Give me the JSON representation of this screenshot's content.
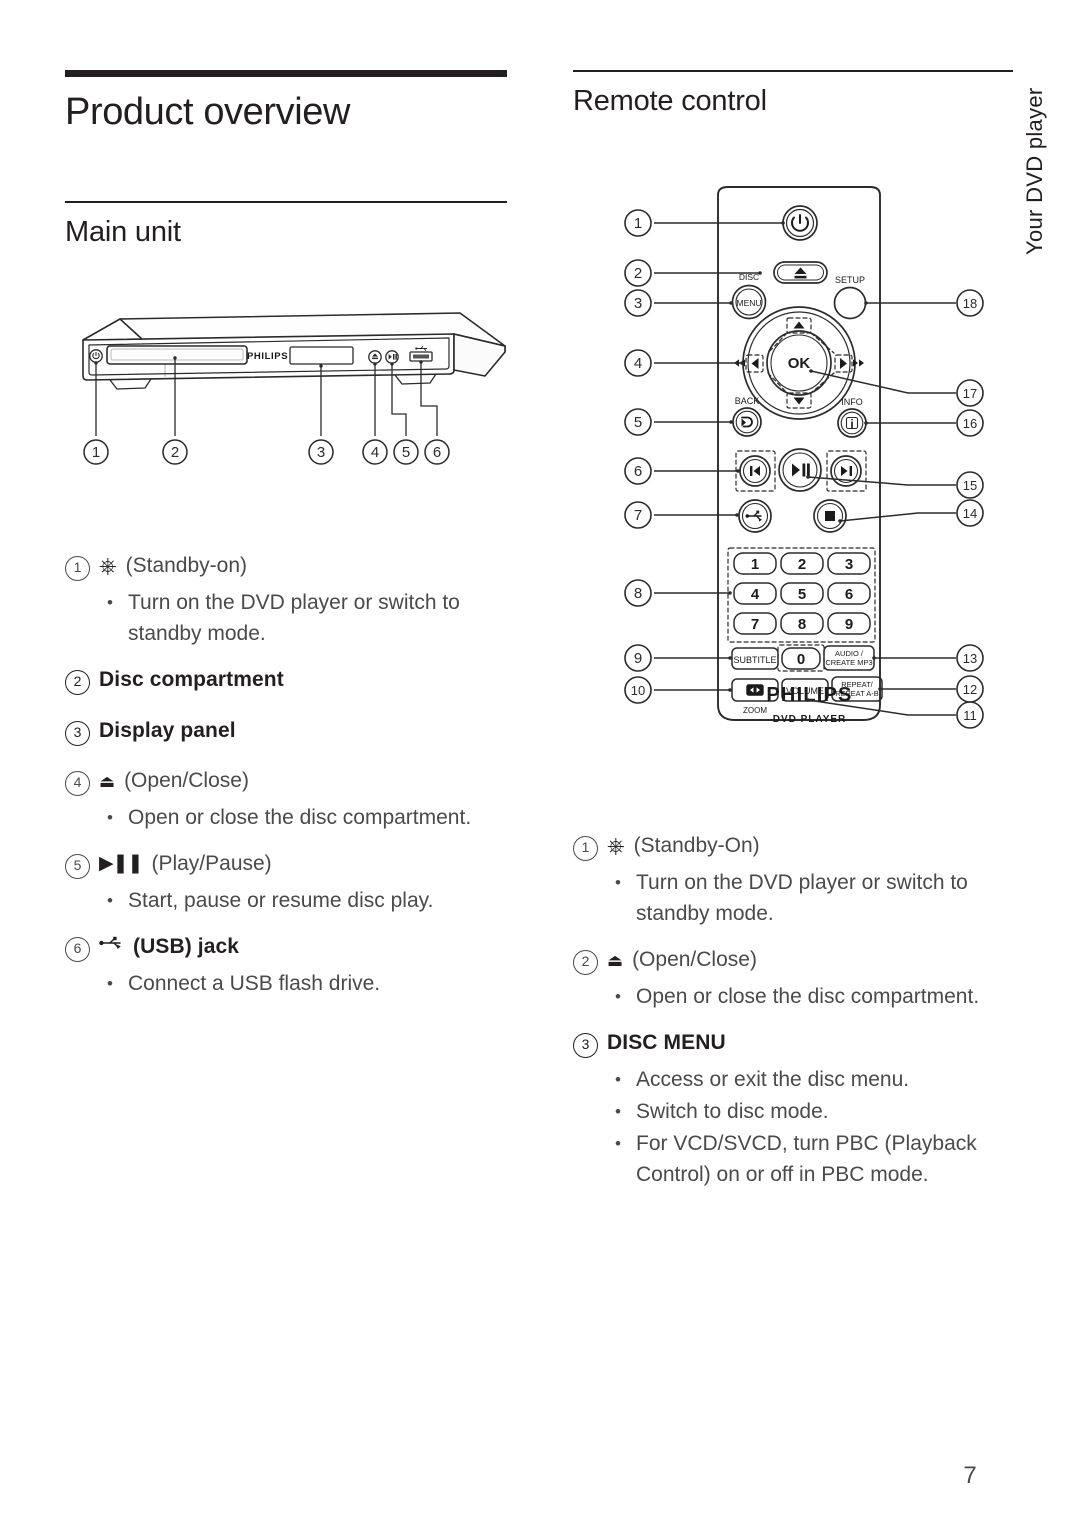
{
  "page": {
    "number": "7",
    "side_tab": "Your DVD player"
  },
  "left_column": {
    "title": "Product overview",
    "section_title": "Main unit",
    "entries": [
      {
        "num": "1",
        "icon": "power-standby-icon",
        "label": "(Standby-on)",
        "bold": false,
        "bullets": [
          "Turn on the DVD player or switch to standby mode."
        ]
      },
      {
        "num": "2",
        "icon": "",
        "label": "Disc compartment",
        "bold": true,
        "bullets": []
      },
      {
        "num": "3",
        "icon": "",
        "label": "Display panel",
        "bold": true,
        "bullets": []
      },
      {
        "num": "4",
        "icon": "eject-icon",
        "label": "(Open/Close)",
        "bold": false,
        "bullets": [
          "Open or close the disc compartment."
        ]
      },
      {
        "num": "5",
        "icon": "play-pause-icon",
        "label": "(Play/Pause)",
        "bold": false,
        "bullets": [
          "Start, pause or resume disc play."
        ]
      },
      {
        "num": "6",
        "icon": "usb-icon",
        "label": "(USB) jack",
        "bold": true,
        "bullets": [
          "Connect a USB flash drive."
        ]
      }
    ]
  },
  "right_column": {
    "section_title": "Remote control",
    "entries": [
      {
        "num": "1",
        "icon": "power-standby-icon",
        "label": "(Standby-On)",
        "bold": false,
        "bullets": [
          "Turn on the DVD player or switch to standby mode."
        ]
      },
      {
        "num": "2",
        "icon": "eject-icon",
        "label": "(Open/Close)",
        "bold": false,
        "bullets": [
          "Open or close the disc compartment."
        ]
      },
      {
        "num": "3",
        "icon": "",
        "label": "DISC MENU",
        "bold": true,
        "bullets": [
          "Access or exit the disc menu.",
          "Switch to disc mode.",
          "For VCD/SVCD, turn PBC (Playback Control) on or off in PBC mode."
        ]
      }
    ]
  },
  "main_unit_diagram": {
    "brand": "PHILIPS",
    "callouts": [
      "1",
      "2",
      "3",
      "4",
      "5",
      "6"
    ],
    "parts": {
      "standby": "power-standby-icon",
      "disc_tray": "disc-compartment",
      "display": "display-panel",
      "eject": "eject-icon",
      "play_pause": "play-pause-icon",
      "usb": "usb-icon"
    }
  },
  "remote_diagram": {
    "brand": "PHILIPS",
    "brand_sub": "DVD PLAYER",
    "left_callouts": [
      "1",
      "2",
      "3",
      "4",
      "5",
      "6",
      "7",
      "8",
      "9",
      "10"
    ],
    "right_callouts": [
      "18",
      "17",
      "16",
      "15",
      "14",
      "13",
      "12",
      "11"
    ],
    "buttons": {
      "disc_menu_top": "DISC",
      "disc_menu": "MENU",
      "setup": "SETUP",
      "ok": "OK",
      "back": "BACK",
      "info": "INFO",
      "subtitle": "SUBTITLE",
      "zero": "0",
      "audio": "AUDIO /",
      "audio2": "CREATE MP3",
      "zoom_label": "ZOOM",
      "volume": "VOLUME",
      "repeat": "REPEAT/",
      "repeat2": "REPEAT A-B",
      "keypad": [
        "1",
        "2",
        "3",
        "4",
        "5",
        "6",
        "7",
        "8",
        "9"
      ]
    }
  },
  "colors": {
    "ink": "#231f20",
    "body_text": "#4a4a4a",
    "line": "#3a3a3a"
  }
}
